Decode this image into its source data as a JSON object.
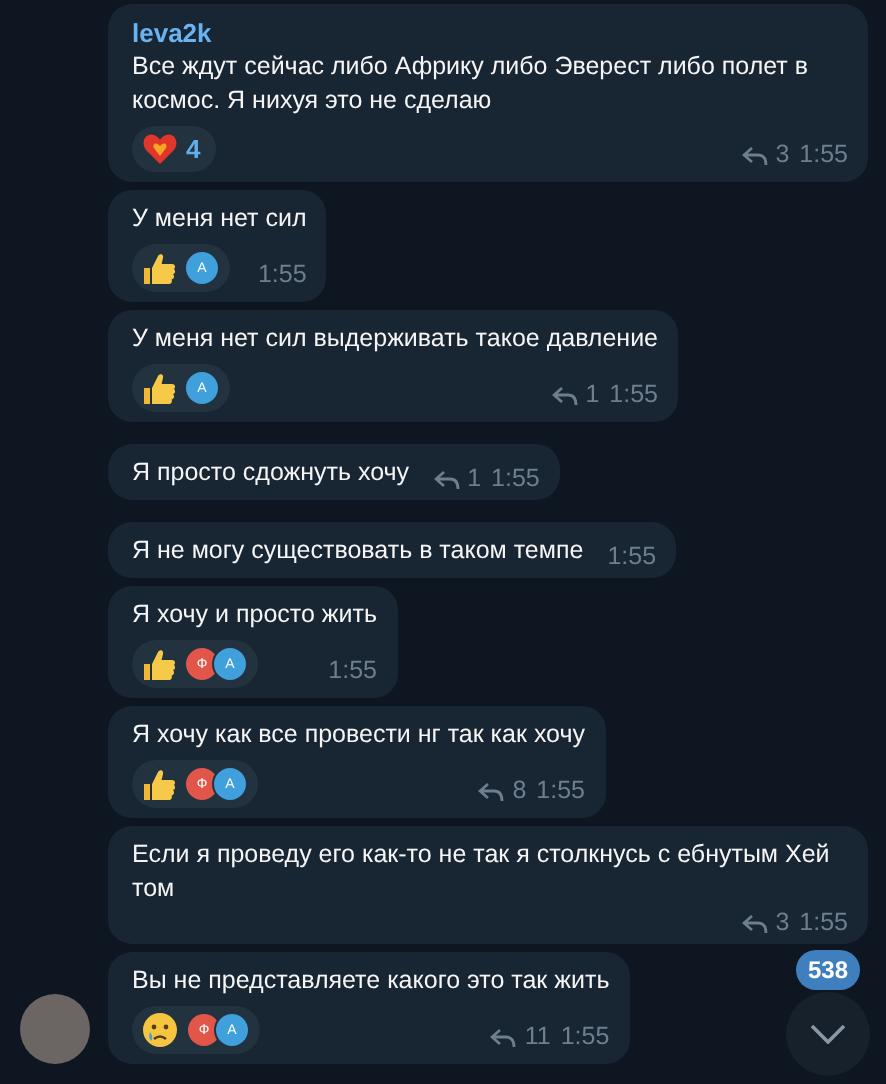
{
  "messages": [
    {
      "sender": "leva2k",
      "text": "Все ждут сейчас либо Африку либо Эверест либо полет в космос. Я нихуя это не сделаю",
      "reaction": {
        "kind": "heart",
        "count": "4"
      },
      "replies": "3",
      "time": "1:55",
      "avatar": false
    },
    {
      "text": "У меня нет сил",
      "reaction": {
        "kind": "thumbs-up",
        "avatars": [
          {
            "letter": "А",
            "color": "#3fa0dc"
          }
        ]
      },
      "time": "1:55",
      "avatar": false
    },
    {
      "text": "У меня нет сил выдерживать такое давление",
      "reaction": {
        "kind": "thumbs-up",
        "avatars": [
          {
            "letter": "А",
            "color": "#3fa0dc"
          }
        ]
      },
      "replies": "1",
      "time": "1:55",
      "avatar": false
    },
    {
      "text": "Я просто сдожнуть хочу",
      "replies": "1",
      "time": "1:55",
      "avatar": false
    },
    {
      "text": "Я не могу существовать в таком темпе",
      "time": "1:55",
      "avatar": false
    },
    {
      "text": "Я хочу и просто жить",
      "reaction": {
        "kind": "thumbs-up",
        "avatars": [
          {
            "letter": "Ф",
            "color": "#e2564a"
          },
          {
            "letter": "А",
            "color": "#3fa0dc"
          }
        ]
      },
      "time": "1:55",
      "avatar": false
    },
    {
      "text": "Я хочу как все провести нг так как хочу",
      "reaction": {
        "kind": "thumbs-up",
        "avatars": [
          {
            "letter": "Ф",
            "color": "#e2564a"
          },
          {
            "letter": "А",
            "color": "#3fa0dc"
          }
        ]
      },
      "replies": "8",
      "time": "1:55",
      "avatar": false
    },
    {
      "text": "Если я проведу его как-то не так я столкнусь с ебнутым Хей том",
      "replies": "3",
      "time": "1:55",
      "avatar": false
    },
    {
      "text": "Вы не представляете какого это так жить",
      "reaction": {
        "kind": "crying",
        "avatars": [
          {
            "letter": "Ф",
            "color": "#e2564a"
          },
          {
            "letter": "А",
            "color": "#3fa0dc"
          }
        ]
      },
      "replies": "11",
      "time": "1:55",
      "avatar": true
    }
  ],
  "scroll_button": {
    "unread": "538"
  }
}
